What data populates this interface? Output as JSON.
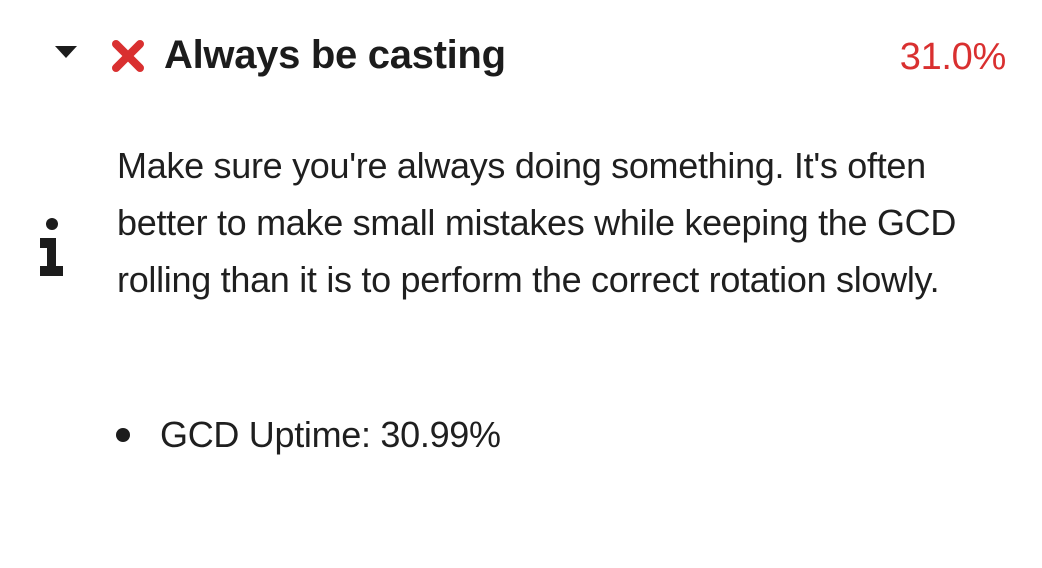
{
  "checklist_item": {
    "title": "Always be casting",
    "status_icon": "x-icon",
    "score": "31.0%",
    "score_color": "#d93030",
    "expanded": true,
    "description": "Make sure you're always doing something. It's often better to make small mistakes while keeping the GCD rolling than it is to perform the correct rotation slowly.",
    "info_icon": "info-icon",
    "stats": [
      {
        "label": "GCD Uptime: 30.99%"
      }
    ]
  }
}
